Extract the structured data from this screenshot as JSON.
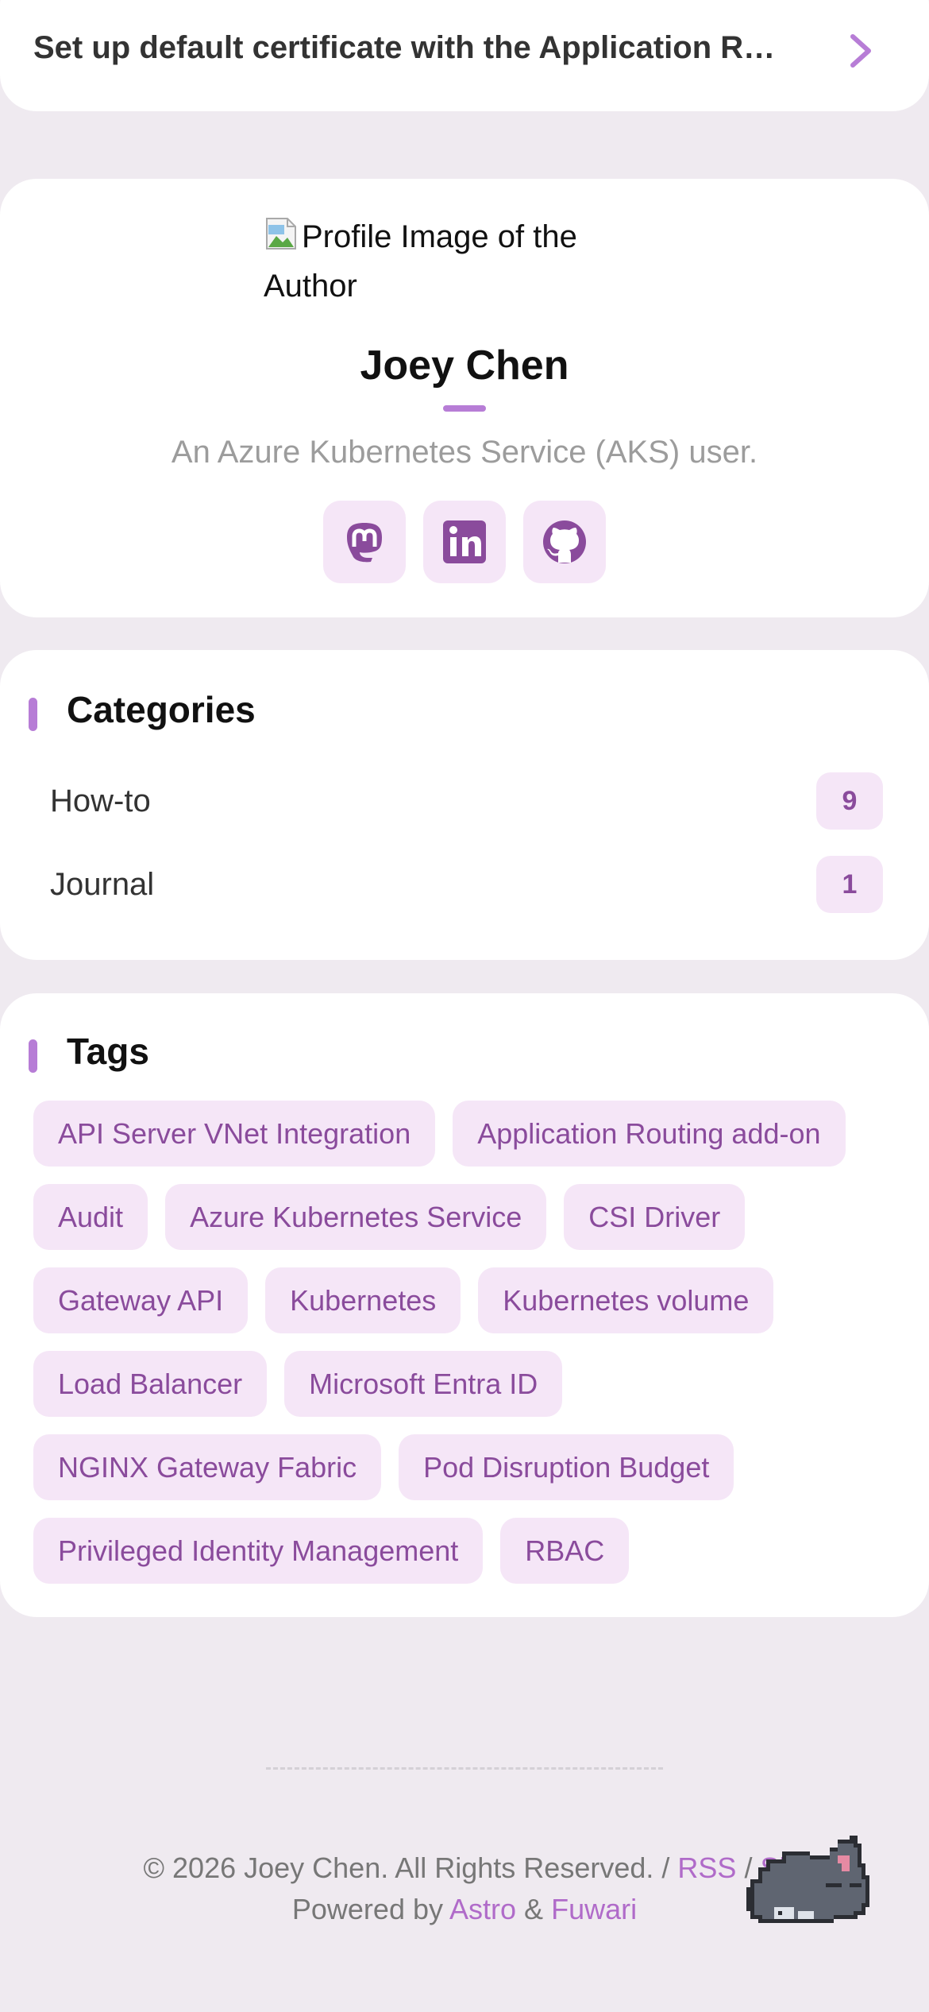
{
  "nav": {
    "next_post_title": "Set up default certificate with the Application Ro…"
  },
  "profile": {
    "avatar_alt": "Profile Image of the Author",
    "name": "Joey Chen",
    "bio": "An Azure Kubernetes Service (AKS) user.",
    "social": [
      {
        "icon": "mastodon-icon"
      },
      {
        "icon": "linkedin-icon"
      },
      {
        "icon": "github-icon"
      }
    ]
  },
  "categories": {
    "title": "Categories",
    "items": [
      {
        "label": "How-to",
        "count": "9"
      },
      {
        "label": "Journal",
        "count": "1"
      }
    ]
  },
  "tags": {
    "title": "Tags",
    "items": [
      "API Server VNet Integration",
      "Application Routing add-on",
      "Audit",
      "Azure Kubernetes Service",
      "CSI Driver",
      "Gateway API",
      "Kubernetes",
      "Kubernetes volume",
      "Load Balancer",
      "Microsoft Entra ID",
      "NGINX Gateway Fabric",
      "Pod Disruption Budget",
      "Privileged Identity Management",
      "RBAC"
    ]
  },
  "footer": {
    "copyright": "© 2026 Joey Chen. All Rights Reserved. /",
    "rss": "RSS",
    "sep": "/",
    "sitemap_partial": "Si",
    "powered_by": "Powered by",
    "astro": "Astro",
    "amp": "&",
    "fuwari": "Fuwari"
  },
  "colors": {
    "accent": "#b77dd6",
    "tag_bg": "#f5e6f7",
    "tag_text": "#8a4b9c",
    "page_bg": "#efeaf0"
  }
}
